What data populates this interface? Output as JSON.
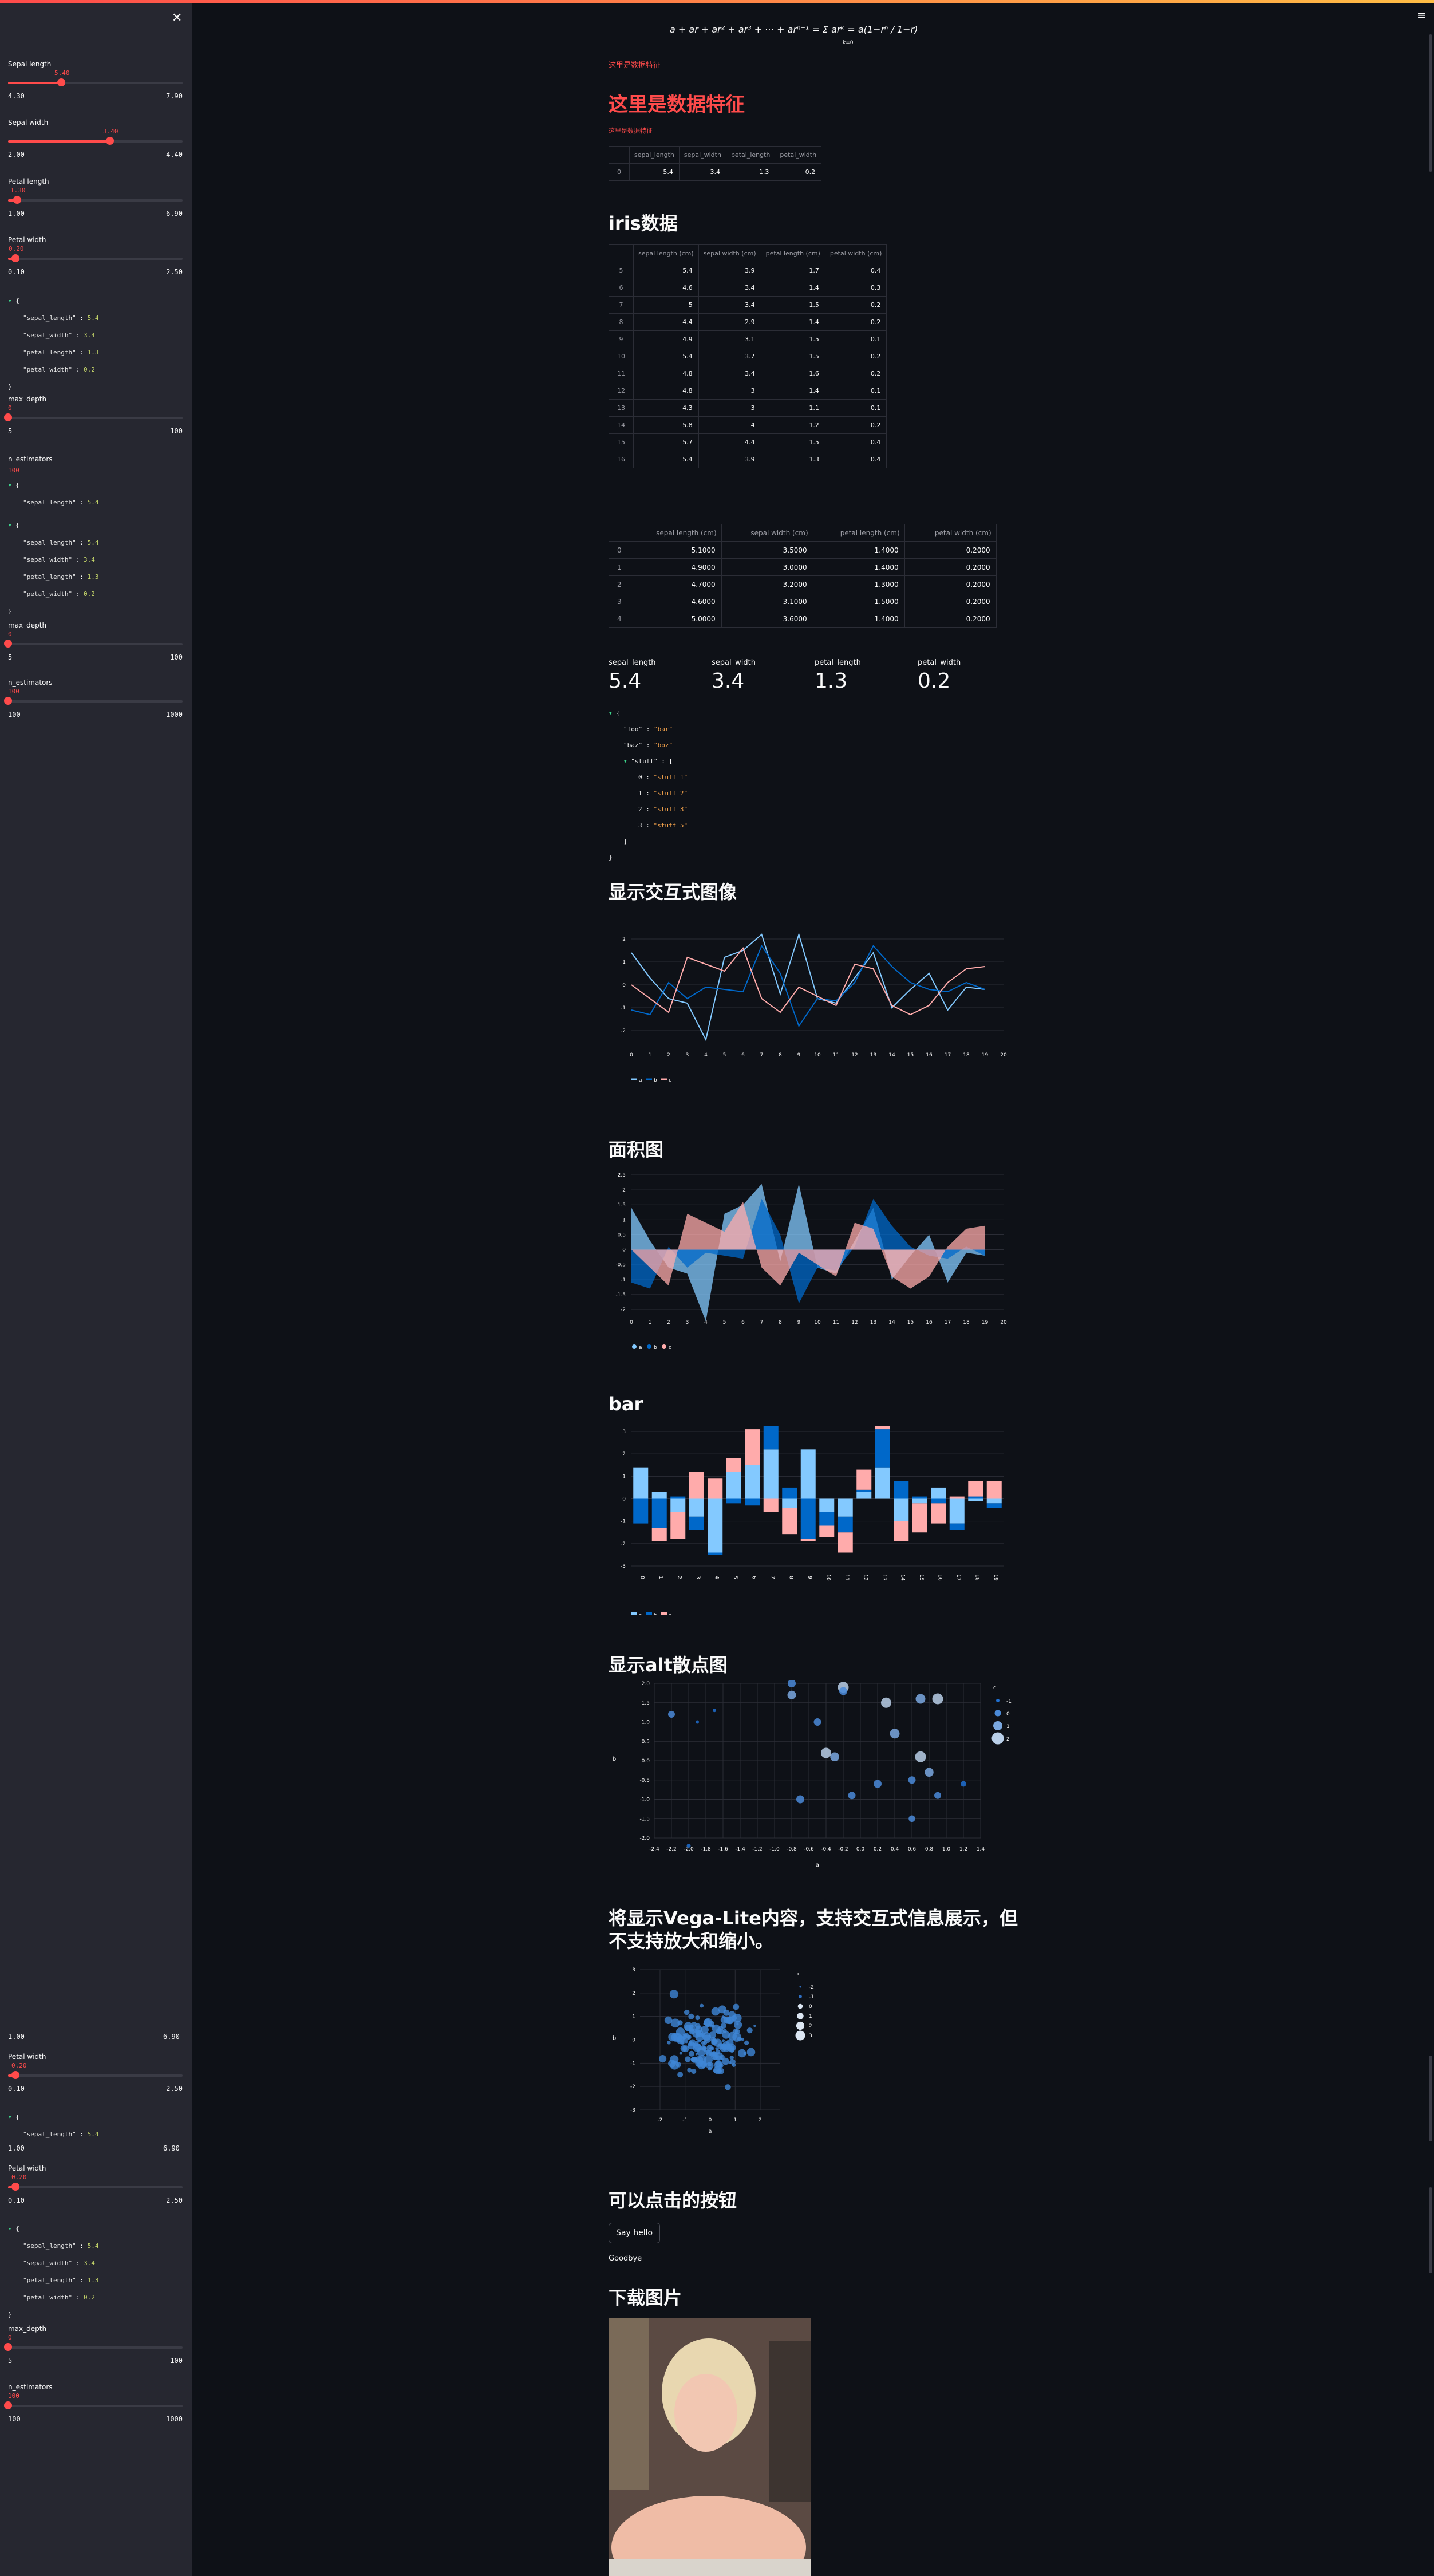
{
  "app": {
    "accent": "#ff4b4b",
    "bg": "#0e1117",
    "sidebar_bg": "#262730"
  },
  "sidebar": {
    "close_icon": "close-icon",
    "sliders_top": [
      {
        "label": "Sepal length",
        "value": "5.40",
        "min": "4.30",
        "max": "7.90",
        "fraction": 0.306
      },
      {
        "label": "Sepal width",
        "value": "3.40",
        "min": "2.00",
        "max": "4.40",
        "fraction": 0.583
      },
      {
        "label": "Petal length",
        "value": "1.30",
        "min": "1.00",
        "max": "6.90",
        "fraction": 0.051
      },
      {
        "label": "Petal width",
        "value": "0.20",
        "min": "0.10",
        "max": "2.50",
        "fraction": 0.042
      }
    ],
    "json1": {
      "k1": "\"sepal_length\"",
      "v1": "5.4",
      "k2": "\"sepal_width\"",
      "v2": "3.4",
      "k3": "\"petal_length\"",
      "v3": "1.3",
      "k4": "\"petal_width\"",
      "v4": "0.2"
    },
    "max_depth": {
      "label": "max_depth",
      "value": "0",
      "min": "5",
      "max": "100",
      "fraction": 0
    },
    "n_estimators": {
      "label": "n_estimators",
      "value": "100",
      "fraction": 0
    },
    "json_sepal": {
      "k": "\"sepal_length\"",
      "v": "5.4"
    },
    "json2": {
      "k1": "\"sepal_length\"",
      "v1": "5.4",
      "k2": "\"sepal_width\"",
      "v2": "3.4",
      "k3": "\"petal_length\"",
      "v3": "1.3",
      "k4": "\"petal_width\"",
      "v4": "0.2"
    },
    "max_depth2": {
      "label": "max_depth",
      "value": "0",
      "min": "5",
      "max": "100",
      "fraction": 0
    },
    "n_estimators2": {
      "label": "n_estimators",
      "value": "100",
      "min": "100",
      "max": "1000",
      "fraction": 0
    },
    "lower": {
      "petal_len_min": "1.00",
      "petal_len_max": "6.90",
      "pw1": {
        "label": "Petal width",
        "value": "0.20",
        "min": "0.10",
        "max": "2.50",
        "fraction": 0.042
      },
      "json_sepal": {
        "k": "\"sepal_length\"",
        "v": "5.4"
      },
      "pl_min": "1.00",
      "pl_max": "6.90",
      "pw2": {
        "label": "Petal width",
        "value": "0.20",
        "min": "0.10",
        "max": "2.50",
        "fraction": 0.042
      },
      "json3": {
        "k1": "\"sepal_length\"",
        "v1": "5.4",
        "k2": "\"sepal_width\"",
        "v2": "3.4",
        "k3": "\"petal_length\"",
        "v3": "1.3",
        "k4": "\"petal_width\"",
        "v4": "0.2"
      },
      "max_depth": {
        "label": "max_depth",
        "value": "0",
        "min": "5",
        "max": "100",
        "fraction": 0
      },
      "n_estimators": {
        "label": "n_estimators",
        "value": "100",
        "min": "100",
        "max": "1000",
        "fraction": 0
      }
    }
  },
  "main": {
    "caption_red": "这里是数据特征",
    "title_red": "这里是数据特征",
    "caption_red_small": "这里是数据特征",
    "feature_table": {
      "headers": [
        "",
        "sepal_length",
        "sepal_width",
        "petal_length",
        "petal_width"
      ],
      "rows": [
        [
          "0",
          "5.4",
          "3.4",
          "1.3",
          "0.2"
        ]
      ]
    },
    "iris_title": "iris数据",
    "iris_table": {
      "headers": [
        "",
        "sepal length (cm)",
        "sepal width (cm)",
        "petal length (cm)",
        "petal width (cm)"
      ],
      "rows": [
        [
          "5",
          "5.4",
          "3.9",
          "1.7",
          "0.4"
        ],
        [
          "6",
          "4.6",
          "3.4",
          "1.4",
          "0.3"
        ],
        [
          "7",
          "5",
          "3.4",
          "1.5",
          "0.2"
        ],
        [
          "8",
          "4.4",
          "2.9",
          "1.4",
          "0.2"
        ],
        [
          "9",
          "4.9",
          "3.1",
          "1.5",
          "0.1"
        ],
        [
          "10",
          "5.4",
          "3.7",
          "1.5",
          "0.2"
        ],
        [
          "11",
          "4.8",
          "3.4",
          "1.6",
          "0.2"
        ],
        [
          "12",
          "4.8",
          "3",
          "1.4",
          "0.1"
        ],
        [
          "13",
          "4.3",
          "3",
          "1.1",
          "0.1"
        ],
        [
          "14",
          "5.8",
          "4",
          "1.2",
          "0.2"
        ],
        [
          "15",
          "5.7",
          "4.4",
          "1.5",
          "0.4"
        ],
        [
          "16",
          "5.4",
          "3.9",
          "1.3",
          "0.4"
        ]
      ]
    },
    "iris_table2": {
      "headers": [
        "",
        "sepal length (cm)",
        "sepal width (cm)",
        "petal length (cm)",
        "petal width (cm)"
      ],
      "rows": [
        [
          "0",
          "5.1000",
          "3.5000",
          "1.4000",
          "0.2000"
        ],
        [
          "1",
          "4.9000",
          "3.0000",
          "1.4000",
          "0.2000"
        ],
        [
          "2",
          "4.7000",
          "3.2000",
          "1.3000",
          "0.2000"
        ],
        [
          "3",
          "4.6000",
          "3.1000",
          "1.5000",
          "0.2000"
        ],
        [
          "4",
          "5.0000",
          "3.6000",
          "1.4000",
          "0.2000"
        ]
      ]
    },
    "metrics": [
      {
        "label": "sepal_length",
        "value": "5.4"
      },
      {
        "label": "sepal_width",
        "value": "3.4"
      },
      {
        "label": "petal_length",
        "value": "1.3"
      },
      {
        "label": "petal_width",
        "value": "0.2"
      }
    ],
    "json": {
      "foo_k": "\"foo\"",
      "foo_v": "\"bar\"",
      "baz_k": "\"baz\"",
      "baz_v": "\"boz\"",
      "stuff_k": "\"stuff\"",
      "s0": "\"stuff 1\"",
      "s1": "\"stuff 2\"",
      "s2": "\"stuff 3\"",
      "s3": "\"stuff 5\""
    },
    "line_title": "显示交互式图像",
    "area_title": "面积图",
    "bar_title": "bar",
    "scatter_title": "显示alt散点图",
    "vega_title": "将显示Vega-Lite内容，支持交互式信息展示，但不支持放大和缩小。",
    "button_title": "可以点击的按钮",
    "button_label": "Say hello",
    "goodbye": "Goodbye",
    "download_title": "下载图片"
  },
  "chart_data": [
    {
      "type": "line",
      "x": [
        0,
        1,
        2,
        3,
        4,
        5,
        6,
        7,
        8,
        9,
        10,
        11,
        12,
        13,
        14,
        15,
        16,
        17,
        18,
        19
      ],
      "series": [
        {
          "name": "a",
          "color": "#83c9ff",
          "values": [
            1.4,
            0.3,
            -0.6,
            -0.8,
            -2.4,
            1.2,
            1.5,
            2.2,
            -0.4,
            2.2,
            -0.6,
            -0.8,
            0.3,
            1.4,
            -1.0,
            -0.2,
            0.5,
            -1.1,
            -0.1,
            -0.2
          ]
        },
        {
          "name": "b",
          "color": "#0068c9",
          "values": [
            -1.1,
            -1.3,
            0.1,
            -0.6,
            -0.1,
            -0.2,
            -0.3,
            1.7,
            0.5,
            -1.8,
            -0.6,
            -0.7,
            0.1,
            1.7,
            0.8,
            0.1,
            -0.2,
            -0.3,
            0.1,
            -0.2
          ]
        },
        {
          "name": "c",
          "color": "#ffabab",
          "values": [
            0,
            -0.6,
            -1.2,
            1.2,
            0.9,
            0.6,
            1.6,
            -0.6,
            -1.2,
            -0.1,
            -0.5,
            -0.9,
            0.9,
            0.7,
            -0.9,
            -1.3,
            -0.9,
            0.1,
            0.7,
            0.8
          ]
        }
      ],
      "ylim": [
        -2.5,
        2.5
      ],
      "legend": "bottom-left"
    },
    {
      "type": "area",
      "x": [
        0,
        1,
        2,
        3,
        4,
        5,
        6,
        7,
        8,
        9,
        10,
        11,
        12,
        13,
        14,
        15,
        16,
        17,
        18,
        19
      ],
      "series": [
        {
          "name": "a",
          "color": "#83c9ff",
          "values": [
            1.4,
            0.3,
            -0.6,
            -0.8,
            -2.4,
            1.2,
            1.5,
            2.2,
            -0.4,
            2.2,
            -0.6,
            -0.8,
            0.3,
            1.4,
            -1.0,
            -0.2,
            0.5,
            -1.1,
            -0.1,
            -0.2
          ]
        },
        {
          "name": "b",
          "color": "#0068c9",
          "values": [
            -1.1,
            -1.3,
            0.1,
            -0.6,
            -0.1,
            -0.2,
            -0.3,
            1.7,
            0.5,
            -1.8,
            -0.6,
            -0.7,
            0.1,
            1.7,
            0.8,
            0.1,
            -0.2,
            -0.3,
            0.1,
            -0.2
          ]
        },
        {
          "name": "c",
          "color": "#ffabab",
          "values": [
            0,
            -0.6,
            -1.2,
            1.2,
            0.9,
            0.6,
            1.6,
            -0.6,
            -1.2,
            -0.1,
            -0.5,
            -0.9,
            0.9,
            0.7,
            -0.9,
            -1.3,
            -0.9,
            0.1,
            0.7,
            0.8
          ]
        }
      ],
      "ylim": [
        -2.0,
        2.5
      ],
      "ticks": [
        -2.0,
        -1.5,
        -1.0,
        -0.5,
        0.0,
        0.5,
        1.0,
        1.5,
        2.0,
        2.5
      ],
      "legend": "bottom-left"
    },
    {
      "type": "bar",
      "categories": [
        "0",
        "1",
        "2",
        "3",
        "4",
        "5",
        "6",
        "7",
        "8",
        "9",
        "10",
        "11",
        "12",
        "13",
        "14",
        "15",
        "16",
        "17",
        "18",
        "19"
      ],
      "series": [
        {
          "name": "a",
          "color": "#83c9ff",
          "values": [
            1.4,
            0.3,
            -0.6,
            -0.8,
            -2.4,
            1.2,
            1.5,
            2.2,
            -0.4,
            2.2,
            -0.6,
            -0.8,
            0.3,
            1.4,
            -1.0,
            -0.2,
            0.5,
            -1.1,
            -0.1,
            -0.2
          ]
        },
        {
          "name": "b",
          "color": "#0068c9",
          "values": [
            -1.1,
            -1.3,
            0.1,
            -0.6,
            -0.1,
            -0.2,
            -0.3,
            1.7,
            0.5,
            -1.8,
            -0.6,
            -0.7,
            0.1,
            1.7,
            0.8,
            0.1,
            -0.2,
            -0.3,
            0.1,
            -0.2
          ]
        },
        {
          "name": "c",
          "color": "#ffabab",
          "values": [
            0,
            -0.6,
            -1.2,
            1.2,
            0.9,
            0.6,
            1.6,
            -0.6,
            -1.2,
            -0.1,
            -0.5,
            -0.9,
            0.9,
            0.7,
            -0.9,
            -1.3,
            -0.9,
            0.1,
            0.7,
            0.8
          ]
        }
      ],
      "ylim": [
        -3,
        3
      ],
      "legend": "bottom-left"
    },
    {
      "type": "scatter",
      "xlabel": "a",
      "ylabel": "b",
      "legend_title": "c",
      "legend_values": [
        "-1",
        "0",
        "1",
        "2"
      ],
      "points": [
        [
          -0.8,
          2.0,
          0.6
        ],
        [
          -0.2,
          1.9,
          1.6
        ],
        [
          -0.8,
          1.7,
          0.8
        ],
        [
          -0.5,
          1.0,
          0.4
        ],
        [
          -0.2,
          1.8,
          0.6
        ],
        [
          0.3,
          1.5,
          1.4
        ],
        [
          0.7,
          1.6,
          1.2
        ],
        [
          0.8,
          -0.3,
          0.9
        ],
        [
          -0.4,
          0.2,
          1.4
        ],
        [
          0.2,
          -0.6,
          0.6
        ],
        [
          -1.9,
          1.0,
          -1.0
        ],
        [
          -1.7,
          1.3,
          -1.0
        ],
        [
          -2.2,
          1.2,
          0.2
        ],
        [
          -2.0,
          -2.2,
          -0.8
        ],
        [
          0.7,
          0.1,
          1.6
        ],
        [
          0.6,
          -0.5,
          0.4
        ],
        [
          0.4,
          0.7,
          1.2
        ],
        [
          0.9,
          -0.9,
          0.2
        ],
        [
          1.2,
          -0.6,
          -0.2
        ],
        [
          0.9,
          1.6,
          1.6
        ],
        [
          0.6,
          -1.5,
          0.1
        ],
        [
          -0.1,
          -0.9,
          0.4
        ],
        [
          -0.7,
          -1.0,
          0.6
        ],
        [
          -0.3,
          0.1,
          0.9
        ]
      ],
      "xlim": [
        -2.4,
        1.4
      ],
      "ylim": [
        -2.0,
        2.0
      ]
    },
    {
      "type": "scatter",
      "xlabel": "a",
      "ylabel": "b",
      "legend_title": "c",
      "legend_values": [
        "-2",
        "-1",
        "0",
        "1",
        "2",
        "3"
      ],
      "xlim": [
        -3,
        3
      ],
      "ylim": [
        -3,
        3
      ]
    }
  ]
}
